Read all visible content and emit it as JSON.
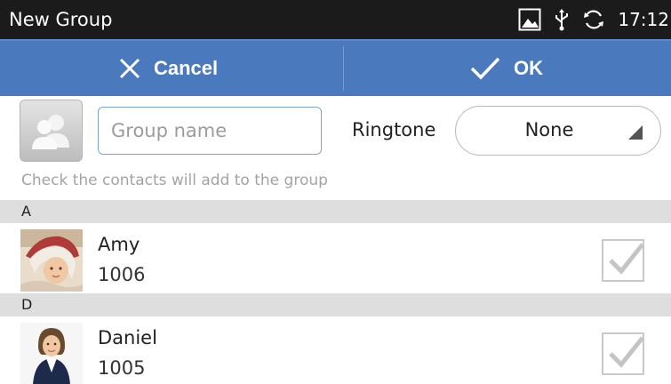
{
  "statusbar": {
    "title": "New Group",
    "time": "17:12",
    "icons": [
      "image-icon",
      "usb-icon",
      "sync-icon"
    ]
  },
  "actionbar": {
    "cancel_label": "Cancel",
    "ok_label": "OK"
  },
  "group": {
    "name_placeholder": "Group name",
    "name_value": "",
    "ringtone_label": "Ringtone",
    "ringtone_value": "None"
  },
  "hint": "Check the contacts will add to the group",
  "sections": [
    {
      "letter": "A",
      "contacts": [
        {
          "name": "Amy",
          "number": "1006",
          "checked": true
        }
      ]
    },
    {
      "letter": "D",
      "contacts": [
        {
          "name": "Daniel",
          "number": "1005",
          "checked": true
        }
      ]
    }
  ],
  "colors": {
    "statusbar_bg": "#1b1b1b",
    "actionbar_bg": "#4b79bd",
    "section_header_bg": "#dedede",
    "hint_text": "#a3a3a3"
  }
}
